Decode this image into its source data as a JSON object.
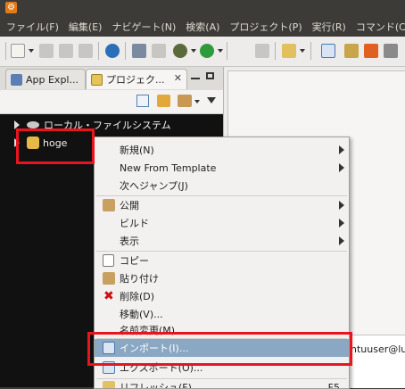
{
  "menubar": {
    "items": [
      "ファイル(F)",
      "編集(E)",
      "ナビゲート(N)",
      "検索(A)",
      "プロジェクト(P)",
      "実行(R)",
      "コマンド(C)"
    ]
  },
  "left_view": {
    "tabs": [
      {
        "label": "App Expl...",
        "icon": "app-explorer-icon"
      },
      {
        "label": "プロジェク...",
        "icon": "project-folder-icon",
        "close": "✕"
      }
    ],
    "tree": [
      {
        "label": "ローカル・ファイルシステム",
        "icon": "drive-icon"
      },
      {
        "label": "hoge",
        "icon": "project-icon"
      }
    ]
  },
  "context_menu": {
    "items": [
      {
        "label": "新規(N)",
        "submenu": true
      },
      {
        "label": "New From Template",
        "submenu": true
      },
      {
        "label": "次へジャンプ(J)"
      },
      {
        "label": "公開",
        "submenu": true,
        "icon": "publish-icon"
      },
      {
        "label": "ビルド",
        "submenu": true
      },
      {
        "label": "表示",
        "submenu": true
      },
      {
        "label": "コピー",
        "icon": "copy-icon"
      },
      {
        "label": "貼り付け",
        "icon": "paste-icon"
      },
      {
        "label": "削除(D)",
        "icon": "delete-icon"
      },
      {
        "label": "移動(V)..."
      },
      {
        "label": "名前変更(M)..."
      },
      {
        "label": "インポート(I)...",
        "icon": "import-icon",
        "highlighted": true
      },
      {
        "label": "エクスポート(O)...",
        "icon": "export-icon"
      },
      {
        "label": "リフレッシュ(F)",
        "icon": "refresh-icon",
        "accel": "F5"
      }
    ]
  },
  "right_pane": {
    "partial_text": "ntuuser@lu"
  },
  "colors": {
    "annotation_red": "#e8141e",
    "menu_highlight": "#8aa8c4",
    "tree_background": "#111111"
  }
}
